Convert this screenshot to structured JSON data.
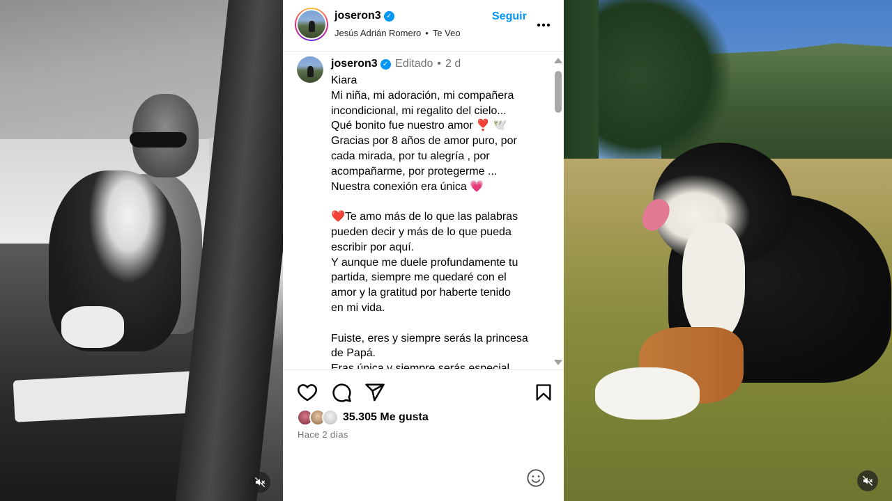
{
  "post": {
    "username": "joseron3",
    "verified_mark": "✓",
    "audio": {
      "artist": "Jesús Adrián Romero",
      "separator": "•",
      "track": "Te Veo"
    },
    "follow_label": "Seguir",
    "more_label": "•••"
  },
  "caption": {
    "username": "joseron3",
    "edited_label": "Editado",
    "separator": "•",
    "time": "2 d",
    "paragraphs": [
      [
        "Kiara",
        "Mi niña, mi adoración, mi compañera",
        "incondicional, mi regalito del cielo...",
        "Qué bonito fue nuestro amor ❣️ 🕊️",
        "Gracias por 8 años de amor puro, por",
        "cada mirada, por tu alegría , por",
        "acompañarme, por protegerme ...",
        "Nuestra conexión era única 💗"
      ],
      [
        "❤️Te amo más de lo que las palabras",
        "pueden decir y más de lo que pueda",
        "escribir por aquí.",
        "Y aunque me duele profundamente tu",
        "partida, siempre me quedaré con el",
        "amor y la gratitud por haberte tenido",
        "en mi vida."
      ],
      [
        "Fuiste, eres y siempre serás la princesa",
        "de Papá.",
        "Eras única y siempre serás especial"
      ]
    ]
  },
  "engagement": {
    "likes_label": "35.305 Me gusta",
    "time_ago": "Hace 2 días"
  },
  "icons": {
    "like": "heart-icon",
    "comment": "comment-icon",
    "share": "share-icon",
    "save": "bookmark-icon",
    "emoji": "emoji-icon",
    "mute": "muted-speaker-icon"
  },
  "colors": {
    "follow_blue": "#0095f6",
    "verified_blue": "#0095f6",
    "secondary_text": "#737373"
  }
}
